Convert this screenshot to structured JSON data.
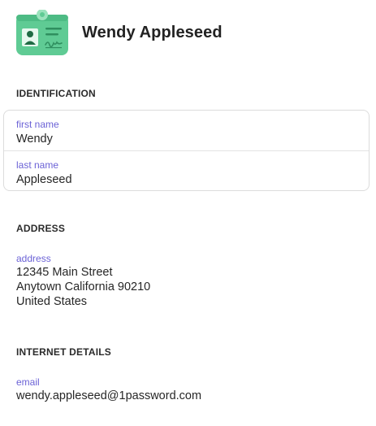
{
  "item": {
    "title": "Wendy Appleseed",
    "icon": "identity-badge-icon",
    "icon_colors": {
      "card": "#5fcb94",
      "card_dark": "#3fa877",
      "clip": "#9be3bd",
      "avatar_bg": "#e6f8ee",
      "avatar": "#1f6b44"
    }
  },
  "sections": {
    "identification": {
      "title": "IDENTIFICATION",
      "first_name": {
        "label": "first name",
        "value": "Wendy"
      },
      "last_name": {
        "label": "last name",
        "value": "Appleseed"
      }
    },
    "address": {
      "title": "ADDRESS",
      "field": {
        "label": "address",
        "line1": "12345 Main Street",
        "line2": "Anytown California 90210",
        "line3": "United States"
      }
    },
    "internet": {
      "title": "INTERNET DETAILS",
      "email": {
        "label": "email",
        "value": "wendy.appleseed@1password.com"
      }
    }
  },
  "colors": {
    "label": "#6b62d6",
    "border": "#dcdcdc"
  }
}
